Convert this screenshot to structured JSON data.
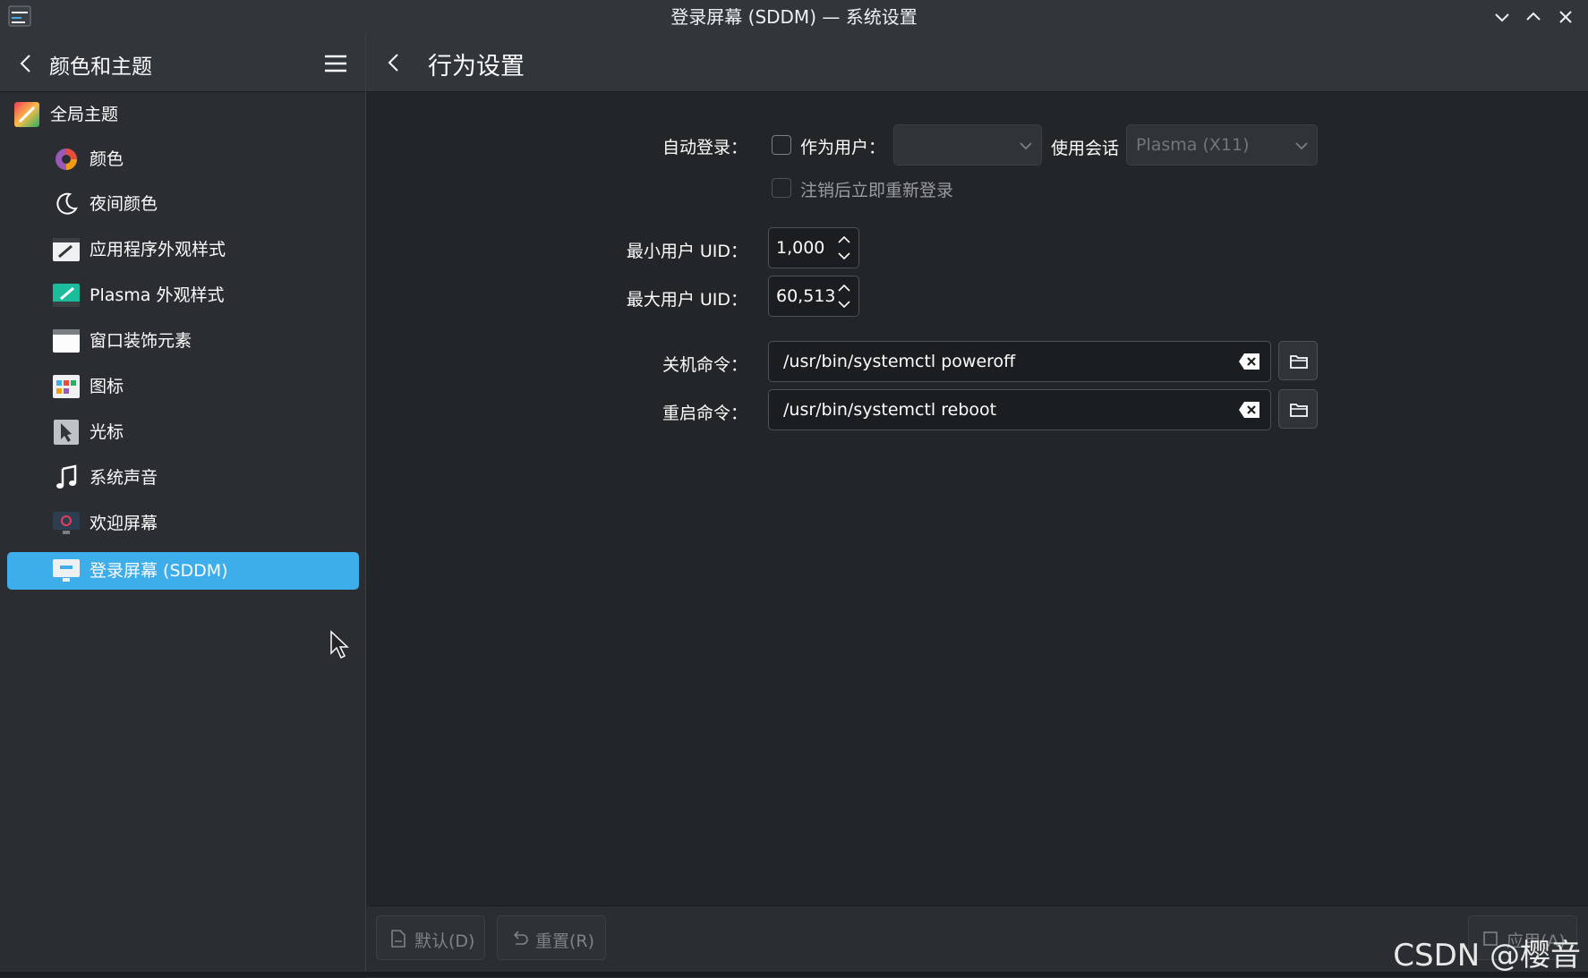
{
  "window": {
    "title": "登录屏幕 (SDDM) — 系统设置"
  },
  "sidebar": {
    "header_title": "颜色和主题",
    "items": [
      {
        "label": "全局主题",
        "icon": "global-theme-icon"
      },
      {
        "label": "颜色",
        "icon": "color-wheel-icon"
      },
      {
        "label": "夜间颜色",
        "icon": "night-color-icon"
      },
      {
        "label": "应用程序外观样式",
        "icon": "app-style-icon"
      },
      {
        "label": "Plasma 外观样式",
        "icon": "plasma-style-icon"
      },
      {
        "label": "窗口装饰元素",
        "icon": "window-decoration-icon"
      },
      {
        "label": "图标",
        "icon": "icons-icon"
      },
      {
        "label": "光标",
        "icon": "cursor-icon"
      },
      {
        "label": "系统声音",
        "icon": "music-note-icon"
      },
      {
        "label": "欢迎屏幕",
        "icon": "splash-screen-icon"
      },
      {
        "label": "登录屏幕 (SDDM)",
        "icon": "login-screen-icon",
        "selected": true
      }
    ]
  },
  "main": {
    "page_title": "行为设置",
    "autologin": {
      "label": "自动登录：",
      "as_user_label": "作为用户：",
      "user_value": "",
      "session_label": "使用会话",
      "session_value": "Plasma (X11)",
      "relogin_label": "注销后立即重新登录"
    },
    "min_uid": {
      "label": "最小用户 UID：",
      "value": "1,000"
    },
    "max_uid": {
      "label": "最大用户 UID：",
      "value": "60,513"
    },
    "halt_cmd": {
      "label": "关机命令：",
      "value": "/usr/bin/systemctl poweroff"
    },
    "reboot_cmd": {
      "label": "重启命令：",
      "value": "/usr/bin/systemctl reboot"
    }
  },
  "footer": {
    "defaults_label": "默认(D)",
    "reset_label": "重置(R)",
    "apply_label": "应用(A)"
  },
  "watermark": "CSDN @樱音",
  "colors": {
    "accent": "#3daee9",
    "background": "#232629",
    "sidebar": "#2a2e32"
  }
}
